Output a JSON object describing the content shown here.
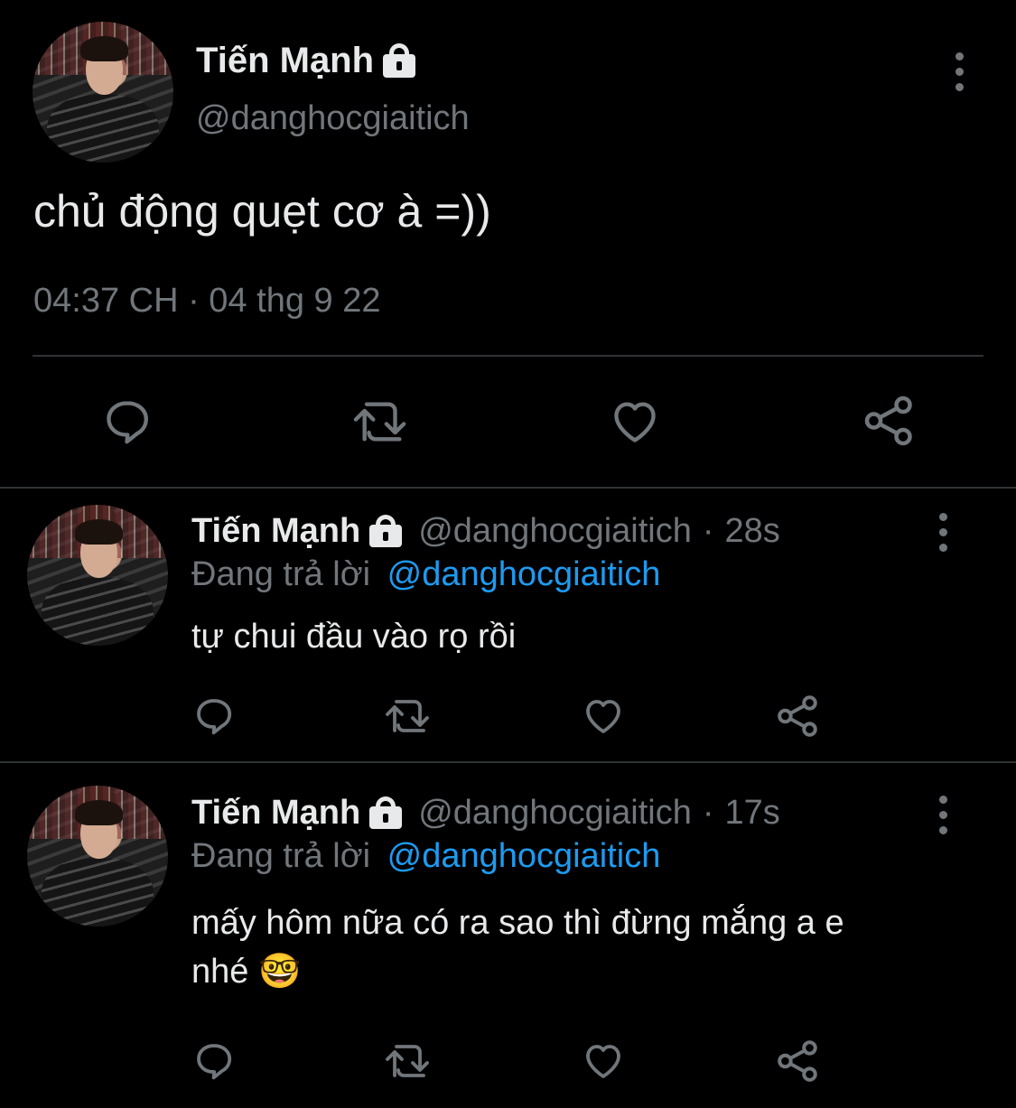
{
  "main_tweet": {
    "display_name": "Tiến Mạnh",
    "handle": "@danghocgiaitich",
    "text": "chủ động quẹt cơ à =))",
    "timestamp": "04:37 CH · 04 thg 9 22",
    "icons": [
      "lock-icon",
      "more-icon",
      "reply-icon",
      "retweet-icon",
      "like-icon",
      "share-icon"
    ]
  },
  "replies": [
    {
      "display_name": "Tiến Mạnh",
      "handle": "@danghocgiaitich",
      "separator": "·",
      "age": "28s",
      "replying_to_prefix": "Đang trả lời",
      "replying_to_handle": "@danghocgiaitich",
      "text": "tự chui đầu vào rọ rồi"
    },
    {
      "display_name": "Tiến Mạnh",
      "handle": "@danghocgiaitich",
      "separator": "·",
      "age": "17s",
      "replying_to_prefix": "Đang trả lời",
      "replying_to_handle": "@danghocgiaitich",
      "text_line1": "mấy hôm nữa có ra sao thì đừng mắng a e",
      "text_line2": "nhé 🤓"
    }
  ],
  "colors": {
    "background": "#000000",
    "text": "#e7e9ea",
    "muted": "#71767b",
    "link": "#1d9bf0",
    "divider": "#2f3336"
  }
}
